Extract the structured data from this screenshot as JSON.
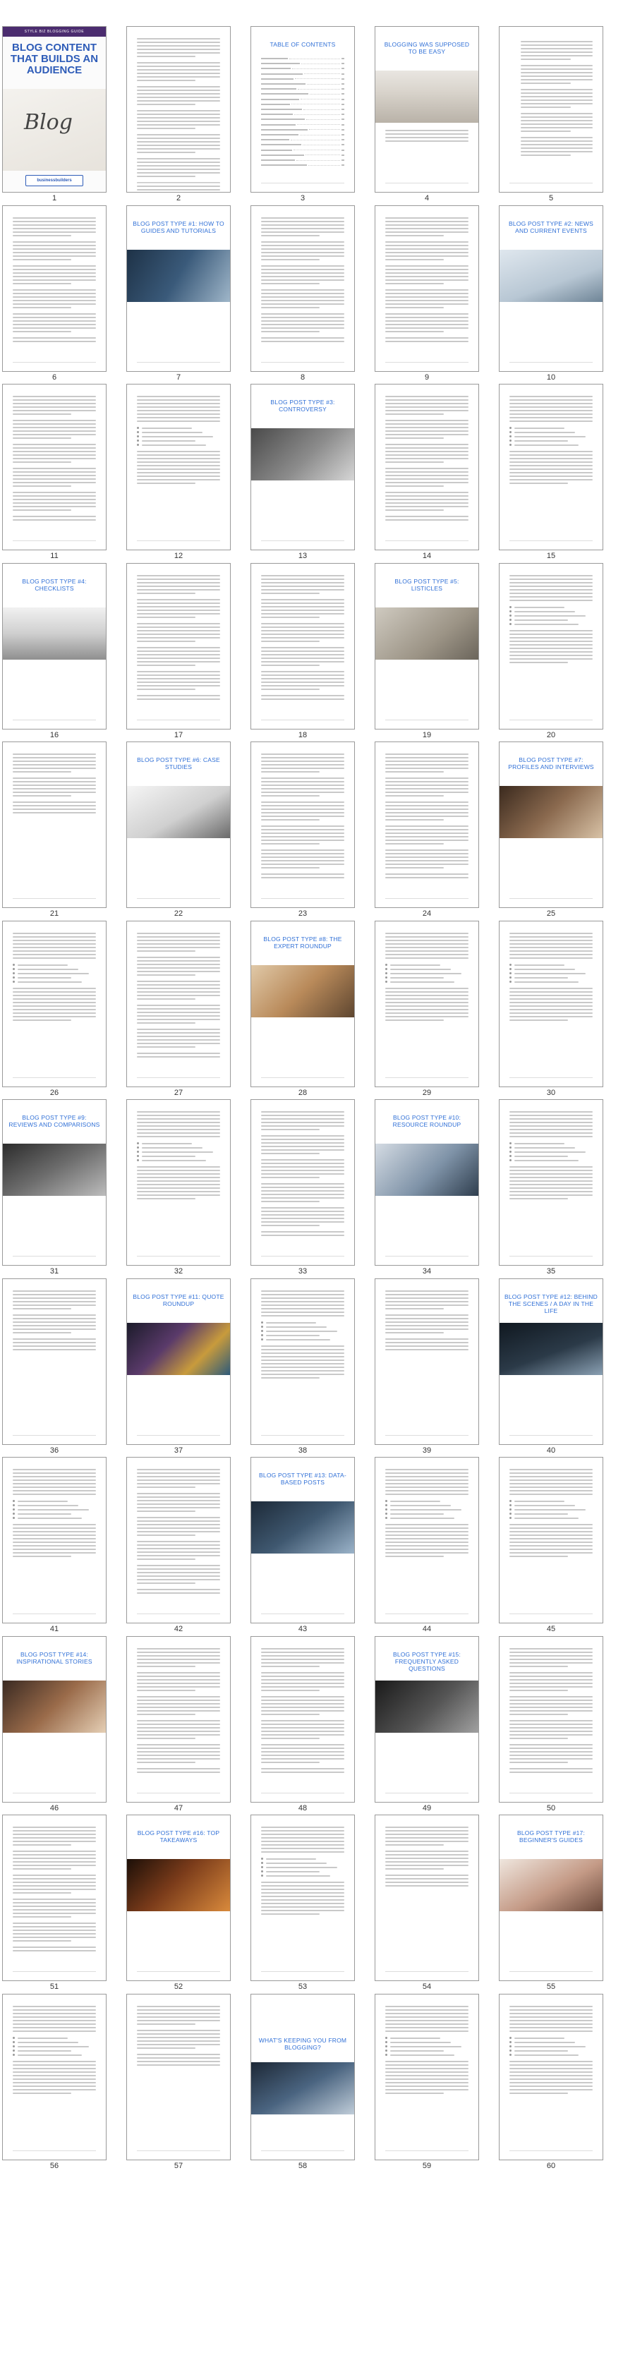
{
  "cover": {
    "band_text": "STYLE  BIZ  BLOGGING  GUIDE",
    "title": "BLOG CONTENT THAT BUILDS AN AUDIENCE",
    "script_word": "Blog",
    "logo_text": "businessbuilders"
  },
  "colors": {
    "title_blue": "#2f6fd6",
    "cover_band": "#4b2c6f",
    "border": "#9a9a9a"
  },
  "pages": [
    {
      "num": "1",
      "kind": "cover"
    },
    {
      "num": "2",
      "kind": "text"
    },
    {
      "num": "3",
      "kind": "toc",
      "title": "TABLE OF CONTENTS"
    },
    {
      "num": "4",
      "kind": "titled",
      "title": "BLOGGING WAS SUPPOSED TO BE EASY",
      "photo": "p4"
    },
    {
      "num": "5",
      "kind": "dropcap"
    },
    {
      "num": "6",
      "kind": "text"
    },
    {
      "num": "7",
      "kind": "titled",
      "title": "BLOG POST TYPE #1: HOW TO GUIDES AND TUTORIALS",
      "photo": "p7"
    },
    {
      "num": "8",
      "kind": "text"
    },
    {
      "num": "9",
      "kind": "text"
    },
    {
      "num": "10",
      "kind": "titled",
      "title": "BLOG POST TYPE #2: NEWS AND CURRENT EVENTS",
      "photo": "p10"
    },
    {
      "num": "11",
      "kind": "text"
    },
    {
      "num": "12",
      "kind": "bullets"
    },
    {
      "num": "13",
      "kind": "titled",
      "title": "BLOG POST TYPE #3: CONTROVERSY",
      "photo": "p13"
    },
    {
      "num": "14",
      "kind": "text"
    },
    {
      "num": "15",
      "kind": "bullets"
    },
    {
      "num": "16",
      "kind": "titled",
      "title": "BLOG POST TYPE #4: CHECKLISTS",
      "photo": "p16"
    },
    {
      "num": "17",
      "kind": "text"
    },
    {
      "num": "18",
      "kind": "text"
    },
    {
      "num": "19",
      "kind": "titled",
      "title": "BLOG POST TYPE #5: LISTICLES",
      "photo": "p19"
    },
    {
      "num": "20",
      "kind": "bullets"
    },
    {
      "num": "21",
      "kind": "short"
    },
    {
      "num": "22",
      "kind": "titled",
      "title": "BLOG POST TYPE #6: CASE STUDIES",
      "photo": "p22"
    },
    {
      "num": "23",
      "kind": "text"
    },
    {
      "num": "24",
      "kind": "text"
    },
    {
      "num": "25",
      "kind": "titled",
      "title": "BLOG POST TYPE #7: PROFILES AND INTERVIEWS",
      "photo": "p25"
    },
    {
      "num": "26",
      "kind": "bullets"
    },
    {
      "num": "27",
      "kind": "text"
    },
    {
      "num": "28",
      "kind": "titled",
      "title": "BLOG POST TYPE #8: THE EXPERT ROUNDUP",
      "photo": "p28"
    },
    {
      "num": "29",
      "kind": "bullets"
    },
    {
      "num": "30",
      "kind": "bullets"
    },
    {
      "num": "31",
      "kind": "titled",
      "title": "BLOG POST TYPE #9: REVIEWS AND COMPARISONS",
      "photo": "p31"
    },
    {
      "num": "32",
      "kind": "bullets"
    },
    {
      "num": "33",
      "kind": "text"
    },
    {
      "num": "34",
      "kind": "titled",
      "title": "BLOG POST TYPE #10: RESOURCE ROUNDUP",
      "photo": "p34"
    },
    {
      "num": "35",
      "kind": "bullets"
    },
    {
      "num": "36",
      "kind": "short"
    },
    {
      "num": "37",
      "kind": "titled",
      "title": "BLOG POST TYPE #11: QUOTE ROUNDUP",
      "photo": "p37"
    },
    {
      "num": "38",
      "kind": "bullets"
    },
    {
      "num": "39",
      "kind": "short"
    },
    {
      "num": "40",
      "kind": "titled",
      "title": "BLOG POST TYPE #12: BEHIND THE SCENES / A DAY IN THE LIFE",
      "photo": "p40"
    },
    {
      "num": "41",
      "kind": "bullets"
    },
    {
      "num": "42",
      "kind": "text"
    },
    {
      "num": "43",
      "kind": "titled",
      "title": "BLOG POST TYPE #13: DATA-BASED POSTS",
      "photo": "p43"
    },
    {
      "num": "44",
      "kind": "bullets"
    },
    {
      "num": "45",
      "kind": "bullets"
    },
    {
      "num": "46",
      "kind": "titled",
      "title": "BLOG POST TYPE #14: INSPIRATIONAL STORIES",
      "photo": "p46"
    },
    {
      "num": "47",
      "kind": "text"
    },
    {
      "num": "48",
      "kind": "text"
    },
    {
      "num": "49",
      "kind": "titled",
      "title": "BLOG POST TYPE #15: FREQUENTLY ASKED QUESTIONS",
      "photo": "p49"
    },
    {
      "num": "50",
      "kind": "text"
    },
    {
      "num": "51",
      "kind": "text"
    },
    {
      "num": "52",
      "kind": "titled",
      "title": "BLOG POST TYPE #16: TOP TAKEAWAYS",
      "photo": "p52"
    },
    {
      "num": "53",
      "kind": "bullets"
    },
    {
      "num": "54",
      "kind": "short"
    },
    {
      "num": "55",
      "kind": "titled",
      "title": "BLOG POST TYPE #17: BEGINNER'S GUIDES",
      "photo": "p55"
    },
    {
      "num": "56",
      "kind": "bullets"
    },
    {
      "num": "57",
      "kind": "short"
    },
    {
      "num": "58",
      "kind": "titled_mid",
      "title": "WHAT'S KEEPING YOU FROM BLOGGING?",
      "photo": "p58"
    },
    {
      "num": "59",
      "kind": "bullets"
    },
    {
      "num": "60",
      "kind": "bullets"
    }
  ]
}
